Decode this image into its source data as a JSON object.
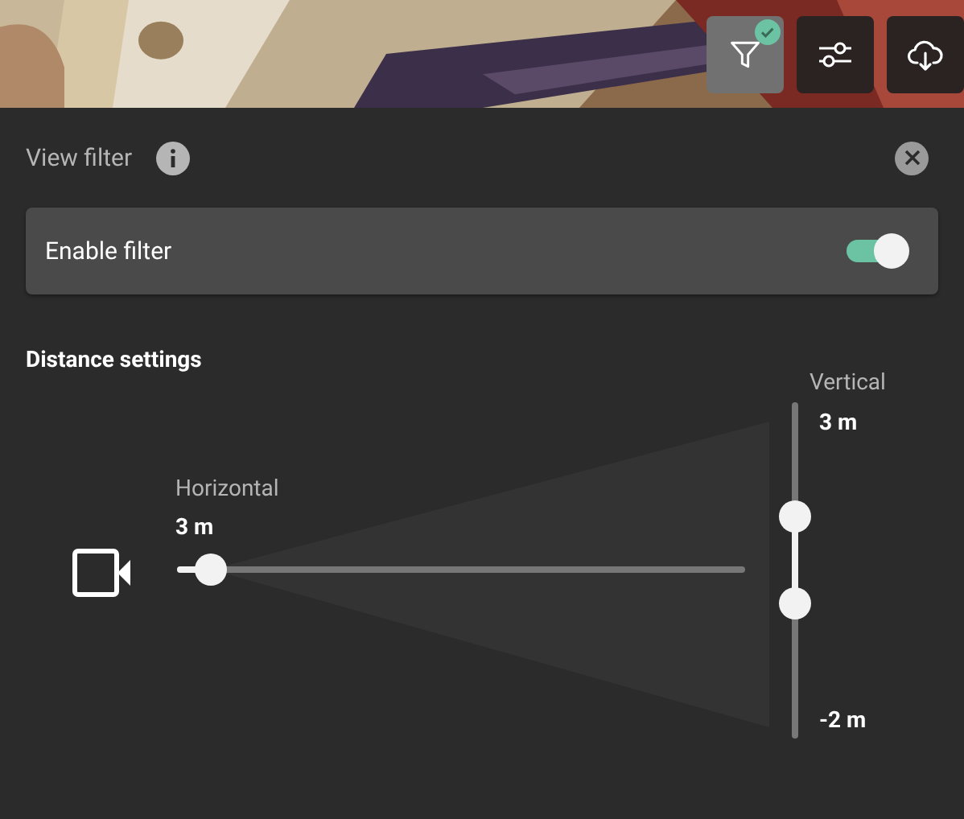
{
  "toolbar": [
    {
      "kind": "filter",
      "selected": true,
      "badge": true
    },
    {
      "kind": "settings",
      "selected": false,
      "badge": false
    },
    {
      "kind": "download",
      "selected": false,
      "badge": false
    }
  ],
  "panel": {
    "title": "View filter",
    "toggle": {
      "label": "Enable filter",
      "on": true
    },
    "section": "Distance settings",
    "horizontal": {
      "label": "Horizontal",
      "reading": "3 m",
      "level": 0.06
    },
    "vertical": {
      "label": "Vertical",
      "top_reading": "3 m",
      "bottom_reading": "-2 m",
      "thumbs": [
        {
          "level": 0.66
        },
        {
          "level": 0.4
        }
      ]
    }
  }
}
